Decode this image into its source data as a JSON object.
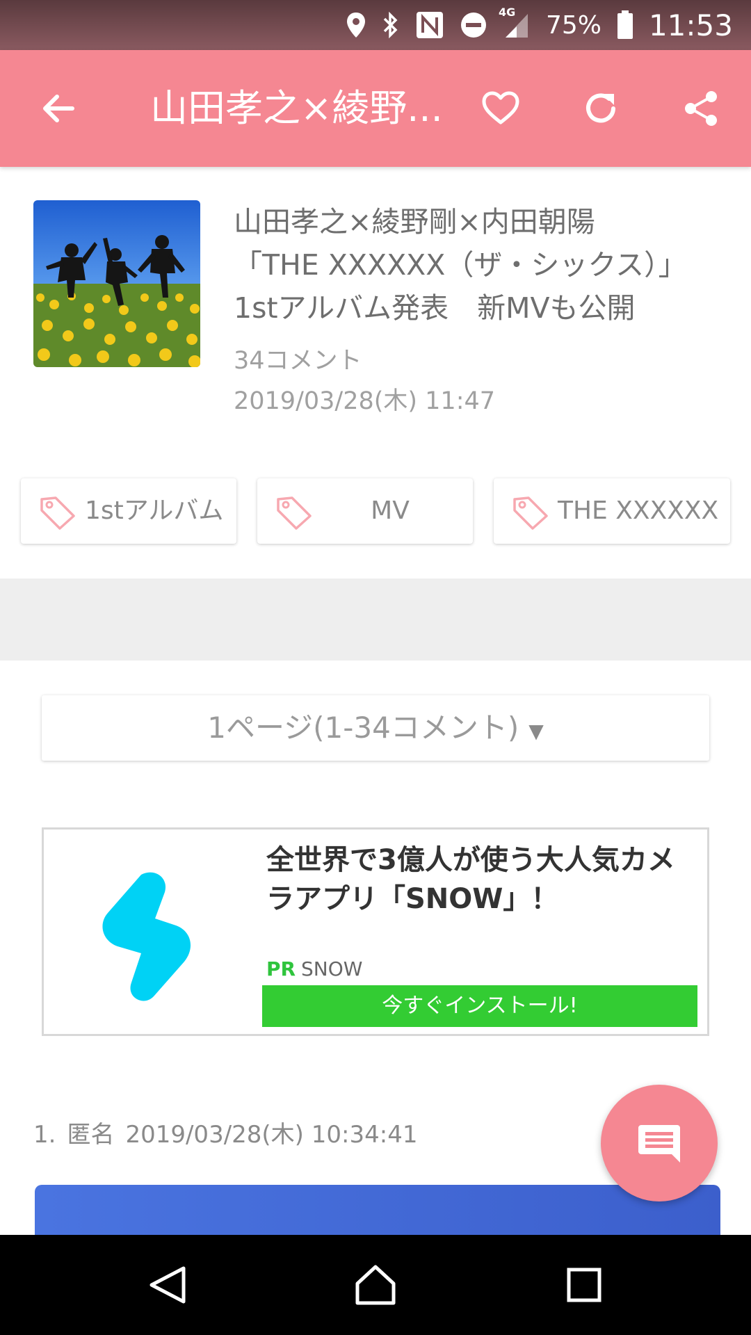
{
  "status_bar": {
    "battery_percent": "75%",
    "time": "11:53",
    "network": "4G",
    "icons": [
      "location-icon",
      "bluetooth-icon",
      "nfc-icon",
      "do-not-disturb-icon",
      "signal-icon",
      "battery-icon"
    ]
  },
  "app_bar": {
    "title": "山田孝之×綾野...",
    "icons": [
      "back-arrow-icon",
      "heart-icon",
      "refresh-icon",
      "share-icon"
    ],
    "color": "#f58792"
  },
  "article": {
    "title_lines": [
      "山田孝之×綾野剛×内田朝陽",
      "「THE XXXXXX（ザ・シックス）」",
      "1stアルバム発表　新MVも公開"
    ],
    "comment_count": "34コメント",
    "date": "2019/03/28(木) 11:47"
  },
  "tags": [
    {
      "label": "1stアルバム"
    },
    {
      "label": "MV"
    },
    {
      "label": "THE XXXXXX"
    }
  ],
  "pager": {
    "label": "1ページ(1-34コメント)",
    "caret": "▼"
  },
  "ad": {
    "headline": "全世界で3億人が使う大人気カメラアプリ「SNOW」！",
    "pr": "PR",
    "advertiser": "SNOW",
    "install_label": "今すぐインストール!",
    "install_color": "#33cc33",
    "logo_color": "#00d2f5"
  },
  "comment": {
    "number": "1.",
    "author": "匿名",
    "timestamp": "2019/03/28(木) 10:34:41"
  },
  "fab": {
    "icon": "comment-icon"
  },
  "nav_bar": {
    "icons": [
      "back-icon",
      "home-icon",
      "recents-icon"
    ]
  }
}
